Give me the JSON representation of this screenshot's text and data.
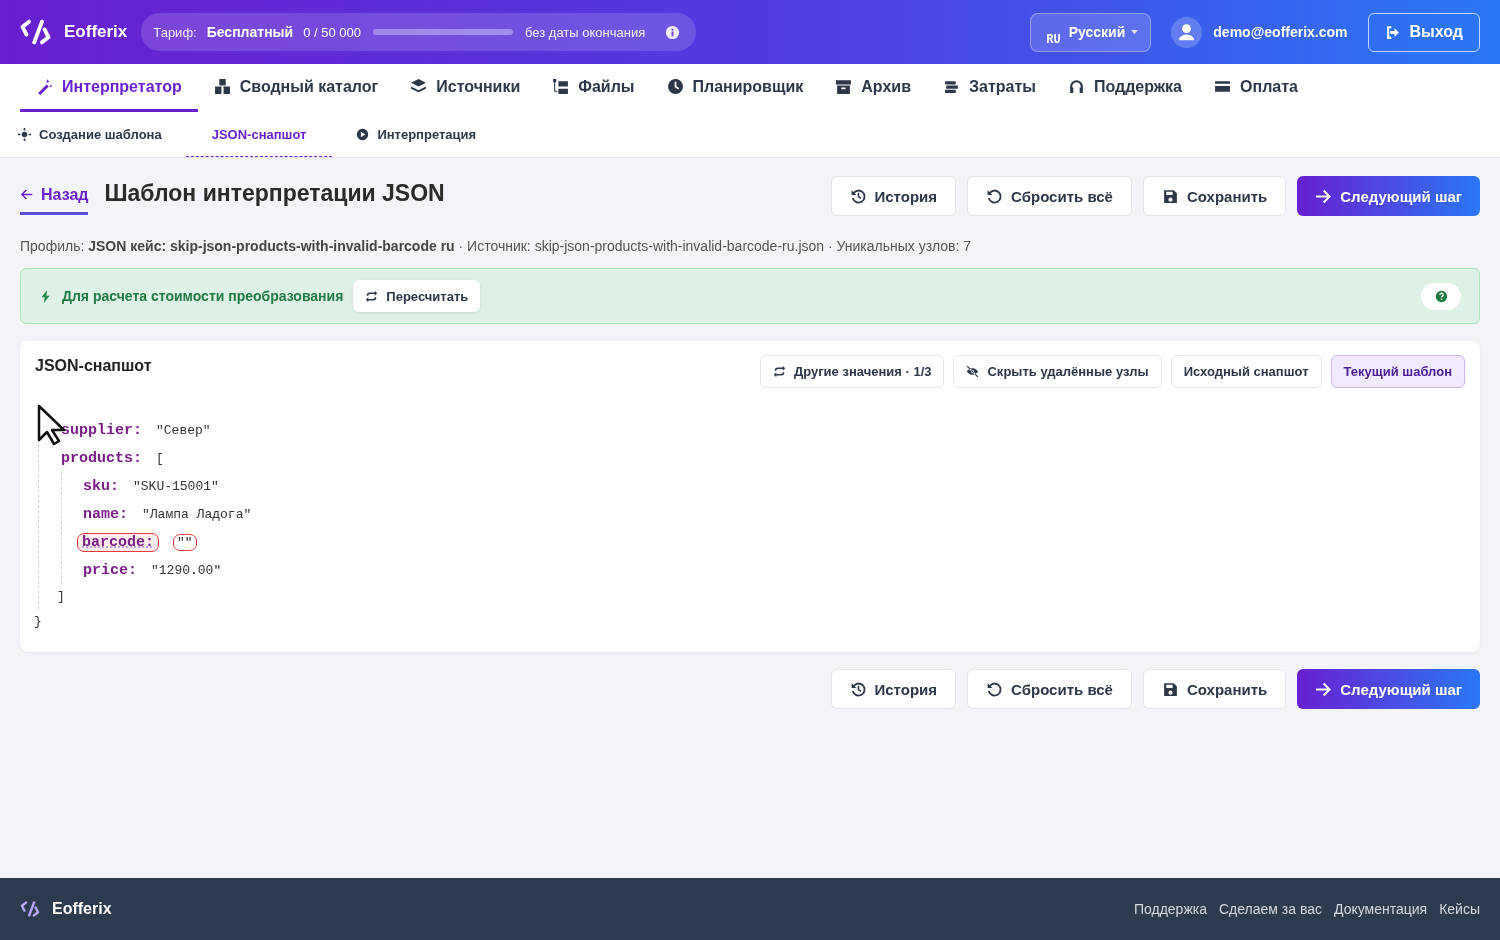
{
  "header": {
    "brand": "Eofferix",
    "plan": {
      "label": "Тариф:",
      "name": "Бесплатный",
      "usage": "0 / 50 000",
      "level": 0,
      "expiry": "без даты окончания"
    },
    "language": {
      "code": "RU",
      "name": "Русский"
    },
    "user": "demo@eofferix.com",
    "logout": "Выход"
  },
  "nav": [
    {
      "label": "Интерпретатор",
      "selected": true
    },
    {
      "label": "Сводный каталог",
      "selected": false
    },
    {
      "label": "Источники",
      "selected": false
    },
    {
      "label": "Файлы",
      "selected": false
    },
    {
      "label": "Планировщик",
      "selected": false
    },
    {
      "label": "Архив",
      "selected": false
    },
    {
      "label": "Затраты",
      "selected": false
    },
    {
      "label": "Поддержка",
      "selected": false
    },
    {
      "label": "Оплата",
      "selected": false
    }
  ],
  "steps": [
    {
      "label": "Создание шаблона",
      "selected": false
    },
    {
      "label": "JSON-снапшот",
      "selected": true
    },
    {
      "label": "Интерпретация",
      "selected": false
    }
  ],
  "page": {
    "back": "Назад",
    "title": "Шаблон интерпретации JSON",
    "actions": [
      {
        "label": "История",
        "kind": "plain"
      },
      {
        "label": "Сбросить всё",
        "kind": "plain"
      },
      {
        "label": "Сохранить",
        "kind": "plain"
      },
      {
        "label": "Следующий шаг",
        "kind": "primary"
      }
    ],
    "meta": "Профиль: **JSON кейс: skip-json-products-with-invalid-barcode ru** · Источник: skip-json-products-with-invalid-barcode-ru.json · Уникальных узлов: 7"
  },
  "notice": {
    "text": "Для расчета стоимости преобразования",
    "button": "Пересчитать"
  },
  "snapshot": {
    "title": "JSON-снапшот",
    "tools": [
      {
        "label": "Другие значения · 1/3",
        "selected": false
      },
      {
        "label": "Скрыть удалённые узлы",
        "selected": false
      },
      {
        "label": "Исходный снапшот",
        "selected": false
      },
      {
        "label": "Текущий шаблон",
        "selected": true
      }
    ],
    "nodes": [
      {
        "key": "supplier:",
        "value": "\"Север\"",
        "invalid": false
      },
      {
        "key": "products:",
        "value": "[",
        "invalid": false,
        "close": "]",
        "children": [
          {
            "key": "sku:",
            "value": "\"SKU-15001\"",
            "invalid": false
          },
          {
            "key": "name:",
            "value": "\"Лампа Ладога\"",
            "invalid": false
          },
          {
            "key": "barcode:",
            "value": "\"\"",
            "invalid": true
          },
          {
            "key": "price:",
            "value": "\"1290.00\"",
            "invalid": false
          }
        ]
      }
    ],
    "close": "}"
  },
  "bottom_actions": [
    {
      "label": "История",
      "kind": "plain"
    },
    {
      "label": "Сбросить всё",
      "kind": "plain"
    },
    {
      "label": "Сохранить",
      "kind": "plain"
    },
    {
      "label": "Следующий шаг",
      "kind": "primary"
    }
  ],
  "footer": {
    "brand": "Eofferix",
    "links": [
      "Поддержка",
      "Сделаем за вас",
      "Документация",
      "Кейсы"
    ]
  }
}
